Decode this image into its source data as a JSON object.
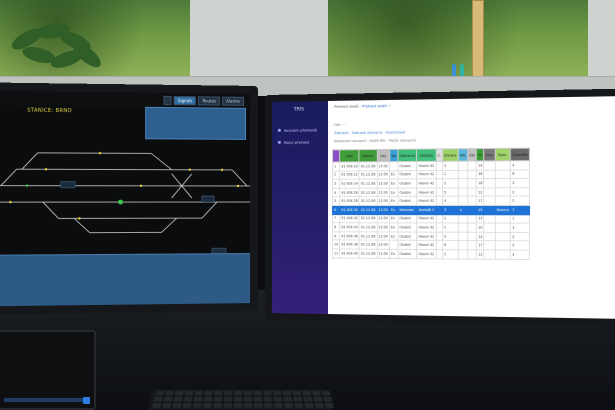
{
  "left_screen": {
    "tabs": [
      "",
      "Signals",
      "Routes",
      "Alarms"
    ],
    "title": "STANICE: BRNO",
    "subtitle": "",
    "bottom_label": "",
    "counter": "",
    "colors": {
      "track": "#d8d8d8",
      "signal_green": "#37c84a",
      "signal_yellow": "#e6cf35",
      "panel_blue": "#2d5f8f"
    }
  },
  "right_screen": {
    "brand": "TRIS",
    "sidebar": [
      {
        "label": "Seznam přehledů",
        "icon": "list-icon"
      },
      {
        "label": "Nový přehled",
        "icon": "plus-icon"
      }
    ],
    "breadcrumb": {
      "prefix": "Přehled vlaků  ·",
      "current": "Přehled vlaků ✓"
    },
    "filter_line_1": "Filtr: ···",
    "filter_line_2": "Zobrazit   ·   Zobrazit záznamy   ·   Exportovat",
    "filter_line_3": "Nastavení sloupců   ·   Uložit filtr   ·   Počet záznamů",
    "columns": [
      "",
      "Vlak",
      "Datum",
      "Čas",
      "Typ",
      "Dopravce",
      "Začátek",
      "Č.",
      "Stanice",
      "Odj.",
      "Km",
      "Pr.",
      "Stav",
      "Pozn.",
      "Zpoždění"
    ],
    "rows": [
      [
        "1",
        "91 456 20",
        "01.12.08",
        "13:30",
        "",
        "Osobní",
        "Hlavní 42",
        "",
        "3",
        "",
        "",
        "14",
        "",
        "",
        "4"
      ],
      [
        "2",
        "91 456 22",
        "01.12.08",
        "13:30",
        "Ex",
        "Osobní",
        "Hlavní 42",
        "",
        "1",
        "",
        "",
        "16",
        "",
        "",
        "6"
      ],
      [
        "3",
        "91 456 24",
        "01.12.08",
        "13:30",
        "Ex",
        "Osobní",
        "Hlavní 42",
        "",
        "2",
        "",
        "",
        "18",
        "",
        "",
        "3"
      ],
      [
        "4",
        "91 456 26",
        "01.12.08",
        "13:30",
        "Ex",
        "Osobní",
        "Hlavní 42",
        "",
        "5",
        "",
        "",
        "12",
        "",
        "",
        "2"
      ],
      [
        "5",
        "91 456 28",
        "01.12.08",
        "13:30",
        "Ex",
        "Osobní",
        "Hlavní 42",
        "",
        "4",
        "",
        "",
        "11",
        "",
        "",
        "2"
      ],
      [
        "6",
        "91 456 30",
        "01.12.08",
        "13:30",
        "Ex",
        "Nákladní",
        "Vedlejší 2",
        "",
        "3",
        "4",
        "",
        "15",
        "",
        "Stanice",
        "7"
      ],
      [
        "7",
        "91 456 32",
        "01.12.08",
        "13:30",
        "Ex",
        "Osobní",
        "Hlavní 42",
        "",
        "2",
        "",
        "",
        "13",
        "",
        "",
        "1"
      ],
      [
        "8",
        "91 456 34",
        "01.12.08",
        "13:30",
        "Ex",
        "Osobní",
        "Hlavní 42",
        "",
        "1",
        "",
        "",
        "10",
        "",
        "",
        "3"
      ],
      [
        "9",
        "91 456 36",
        "01.12.08",
        "13:30",
        "Ex",
        "Osobní",
        "Hlavní 42",
        "",
        "3",
        "",
        "",
        "14",
        "",
        "",
        "2"
      ],
      [
        "10",
        "91 456 38",
        "01.12.08",
        "13:30",
        "",
        "Osobní",
        "Hlavní 42",
        "",
        "6",
        "",
        "",
        "17",
        "",
        "",
        "5"
      ],
      [
        "11",
        "91 456 40",
        "01.12.08",
        "13:30",
        "Ex",
        "Osobní",
        "Hlavní 42",
        "",
        "2",
        "",
        "",
        "12",
        "",
        "",
        "4"
      ]
    ],
    "selected_row_index": 5,
    "header_colors": [
      "#8a4fc4",
      "#3f9d3a",
      "#3f9d3a",
      "#bdbdbd",
      "#3aa0d8",
      "#3fbf7a",
      "#3fbf7a",
      "#e0e0e0",
      "#9fd36a",
      "#5ab7d9",
      "#c1c1c1",
      "#3f9d3a",
      "#7a7a7a",
      "#a0d46b",
      "#6a6a6a"
    ]
  }
}
